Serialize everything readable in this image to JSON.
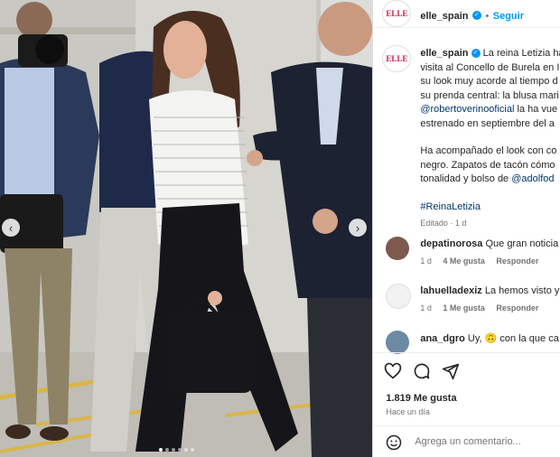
{
  "account": {
    "avatar_text": "ELLE",
    "username": "elle_spain",
    "verified": true,
    "follow_label": "Seguir"
  },
  "caption": {
    "username": "elle_spain",
    "line1": "La reina Letizia ha",
    "line2": "visita al Concello de Burela en I",
    "line3": "su look muy acorde al tiempo d",
    "line4": "su prenda central: la blusa mari",
    "link1": "@robertoverinooficial",
    "line5_rest": " la ha vue",
    "line6": "estrenado en septiembre del a",
    "line7": "Ha acompañado el look con co",
    "line8": "negro. Zapatos de tacón cómo",
    "line9_start": "tonalidad y bolso de ",
    "link2": "@adolfod",
    "hashtag": "#ReinaLetizia",
    "edited": "Editado · 1 d"
  },
  "comments": [
    {
      "username": "depatinorosa",
      "text": "Que gran noticia",
      "age": "1 d",
      "likes": "4 Me gusta",
      "reply": "Responder"
    },
    {
      "username": "lahuelladexiz",
      "text": "La hemos visto y",
      "age": "1 d",
      "likes": "1 Me gusta",
      "reply": "Responder"
    },
    {
      "username": "ana_dgro",
      "text": "Uy, 🙃 con la que ca",
      "age": "",
      "likes": "",
      "reply": ""
    }
  ],
  "actions": {
    "like_icon": "heart-icon",
    "comment_icon": "comment-icon",
    "share_icon": "share-icon"
  },
  "likes_count": "1.819 Me gusta",
  "posted": "Hace un día",
  "add_comment": {
    "placeholder": "Agrega un comentario..."
  },
  "carousel": {
    "dot_count": 6,
    "active_dot": 0
  },
  "colors": {
    "link": "#00376b",
    "follow": "#0095f6",
    "verified": "#0095f6",
    "muted": "#737373"
  }
}
